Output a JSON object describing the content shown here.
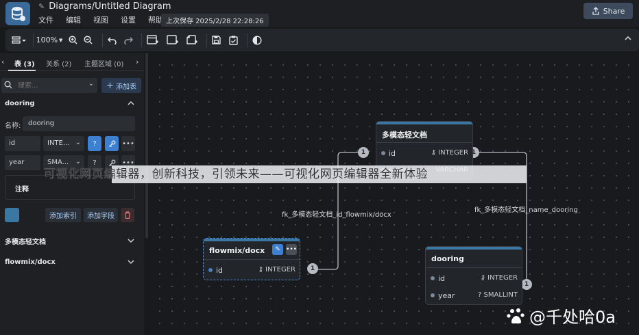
{
  "app": {
    "title": "Diagrams/Untitled Diagram",
    "menu": [
      "文件",
      "编辑",
      "视图",
      "设置",
      "帮助"
    ],
    "save_status": "上次保存 2025/2/28 22:28:26",
    "share_label": "Share"
  },
  "toolbar": {
    "zoom": "100%"
  },
  "sidebar": {
    "tabs": [
      {
        "label": "表 (3)"
      },
      {
        "label": "关系 (2)"
      },
      {
        "label": "主题区域 (0)"
      }
    ],
    "search_placeholder": "搜索...",
    "add_table_label": "添加表",
    "active_table": {
      "name": "dooring",
      "name_label": "名称:",
      "name_value": "dooring",
      "fields": [
        {
          "name": "id",
          "type": "INTE...",
          "null_flag": "?"
        },
        {
          "name": "year",
          "type": "SMA...",
          "null_flag": "?"
        }
      ],
      "comment_label": "注释",
      "add_index_label": "添加索引",
      "add_field_label": "添加字段",
      "color": "#3b77a3"
    },
    "other_tables": [
      "多模态轻文档",
      "flowmix/docx"
    ]
  },
  "canvas": {
    "tables": [
      {
        "name": "多模态轻文档",
        "fields": [
          {
            "name": "id",
            "type": "INTEGER"
          },
          {
            "name": "name",
            "type": "VARCHAR"
          }
        ]
      },
      {
        "name": "flowmix/docx",
        "fields": [
          {
            "name": "id",
            "type": "INTEGER"
          }
        ]
      },
      {
        "name": "dooring",
        "fields": [
          {
            "name": "id",
            "type": "INTEGER"
          },
          {
            "name": "year",
            "type": "? SMALLINT"
          }
        ]
      }
    ],
    "relationships": [
      {
        "label": "fk_多模态轻文档_id_flowmix/docx",
        "badge": "1"
      },
      {
        "label": "fk_多模态轻文档_name_dooring",
        "badge": "1"
      }
    ],
    "badges": [
      "1",
      "1",
      "1",
      "1"
    ]
  },
  "overlay": {
    "caption": "可视化网页编辑器，创新科技，引领未来——可视化网页编辑器全新体验",
    "watermark": "@千处哈0a"
  }
}
